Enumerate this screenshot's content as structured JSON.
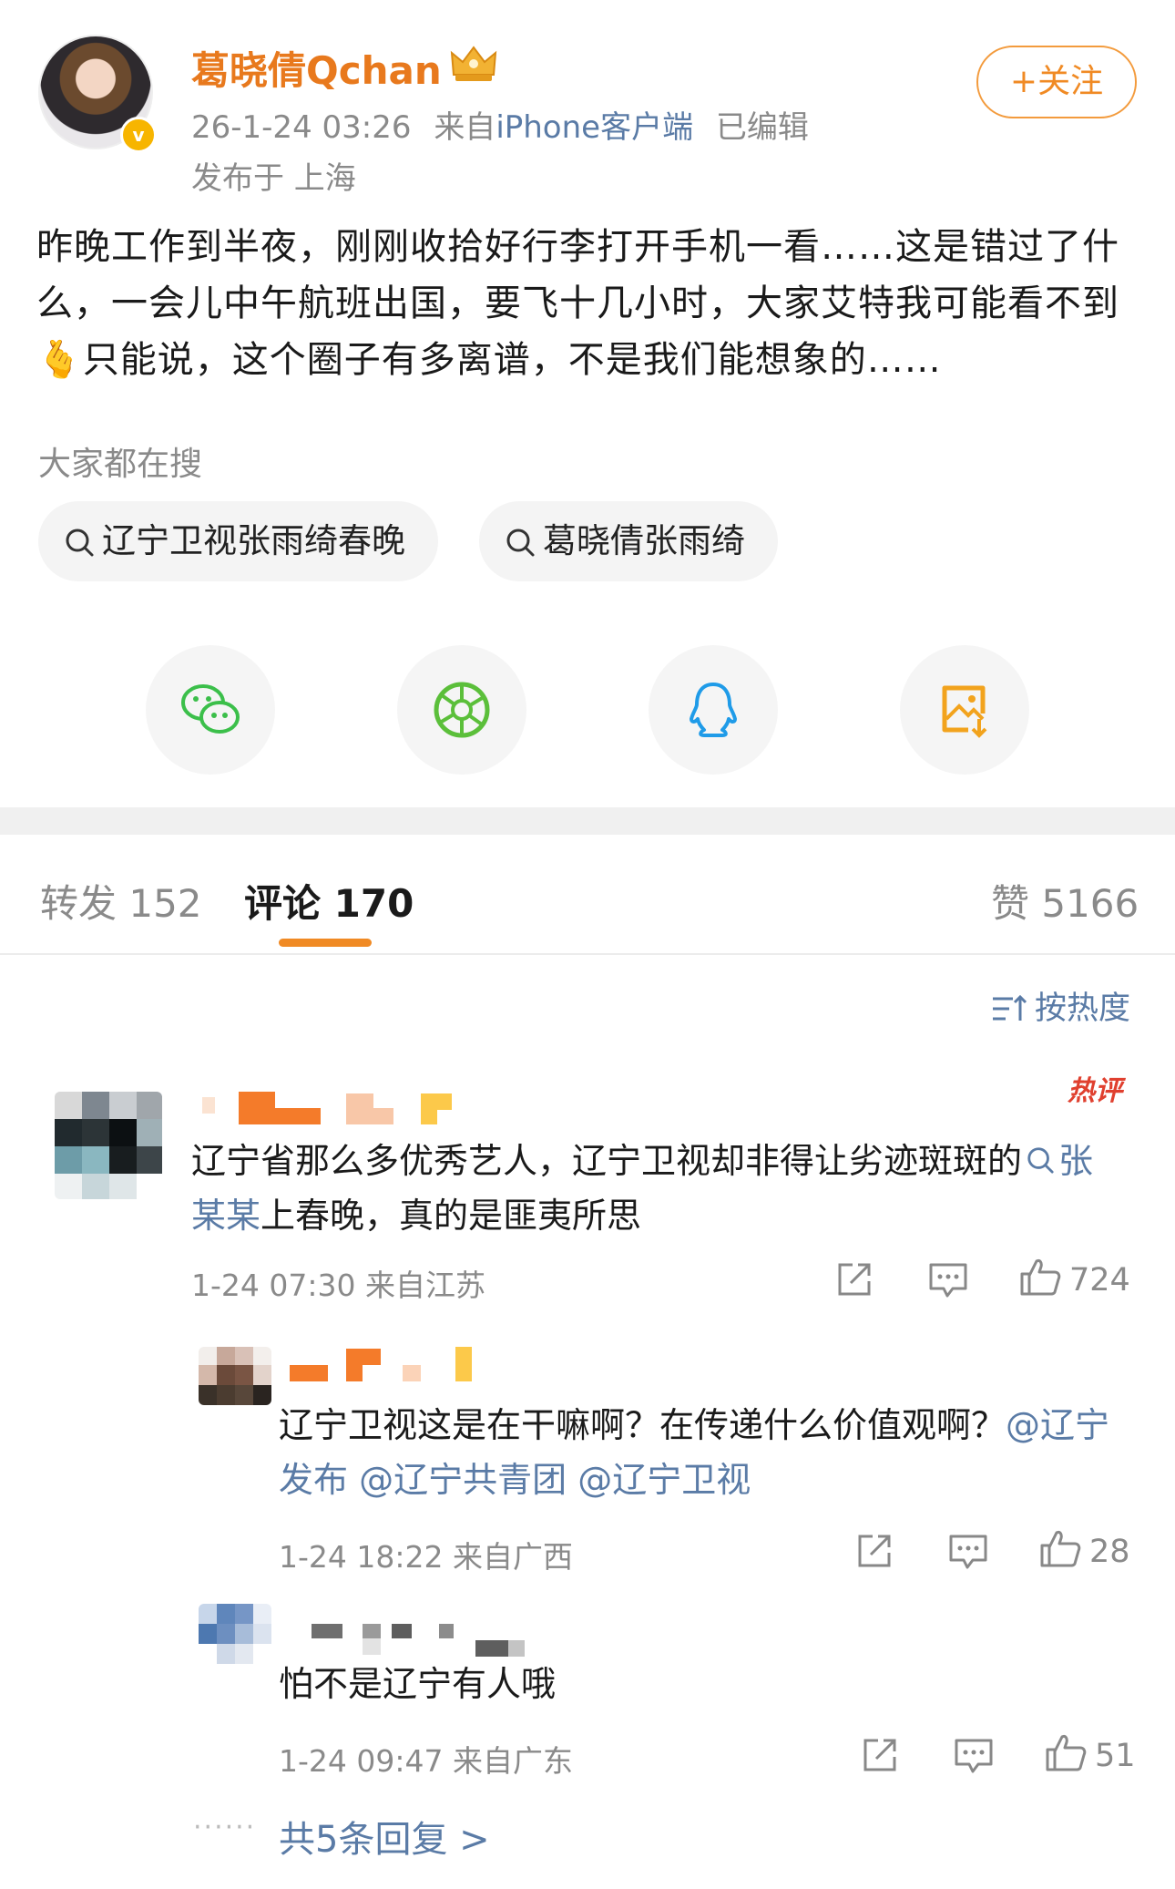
{
  "post": {
    "username": "葛晓倩Qchan",
    "time": "26-1-24 03:26",
    "from_prefix": "来自",
    "source": "iPhone客户端",
    "edited": "已编辑",
    "location": "发布于 上海",
    "follow_label": "+关注",
    "content_1": "昨晚工作到半夜，刚刚收拾好行李打开手机一看……这是错过了什么，一会儿中午航班出国，要飞十几小时，大家艾特我可能看不到",
    "emoji": "🫰",
    "content_2": "只能说，这个圈子有多离谱，不是我们能想象的……"
  },
  "hot_search": {
    "title": "大家都在搜",
    "chips": [
      {
        "label": "辽宁卫视张雨绮春晚"
      },
      {
        "label": "葛晓倩张雨绮"
      }
    ]
  },
  "share_icons": [
    "wechat-icon",
    "moments-icon",
    "qq-icon",
    "save-image-icon"
  ],
  "tabs": {
    "repost": "转发 152",
    "comments": "评论 170",
    "likes": "赞 5166"
  },
  "sort_label": "按热度",
  "comments": [
    {
      "badge": "热评",
      "text_before": "辽宁省那么多优秀艺人，辽宁卫视却非得让劣迹斑斑的",
      "search_link": "张某某",
      "text_after": "上春晚，真的是匪夷所思",
      "time": "1-24 07:30 来自江苏",
      "likes": "724"
    }
  ],
  "replies": [
    {
      "text_before": "辽宁卫视这是在干嘛啊？在传递什么价值观啊？",
      "mention_1": "@辽宁发布",
      "mention_2": "@辽宁共青团",
      "mention_3": "@辽宁卫视",
      "time": "1-24 18:22 来自广西",
      "likes": "28"
    },
    {
      "text": "怕不是辽宁有人哦",
      "time": "1-24 09:47 来自广东",
      "likes": "51"
    }
  ],
  "more_replies": "共5条回复 >",
  "colors": {
    "accent": "#f08a24",
    "link": "#5a7ba6",
    "hot": "#e0402f"
  }
}
